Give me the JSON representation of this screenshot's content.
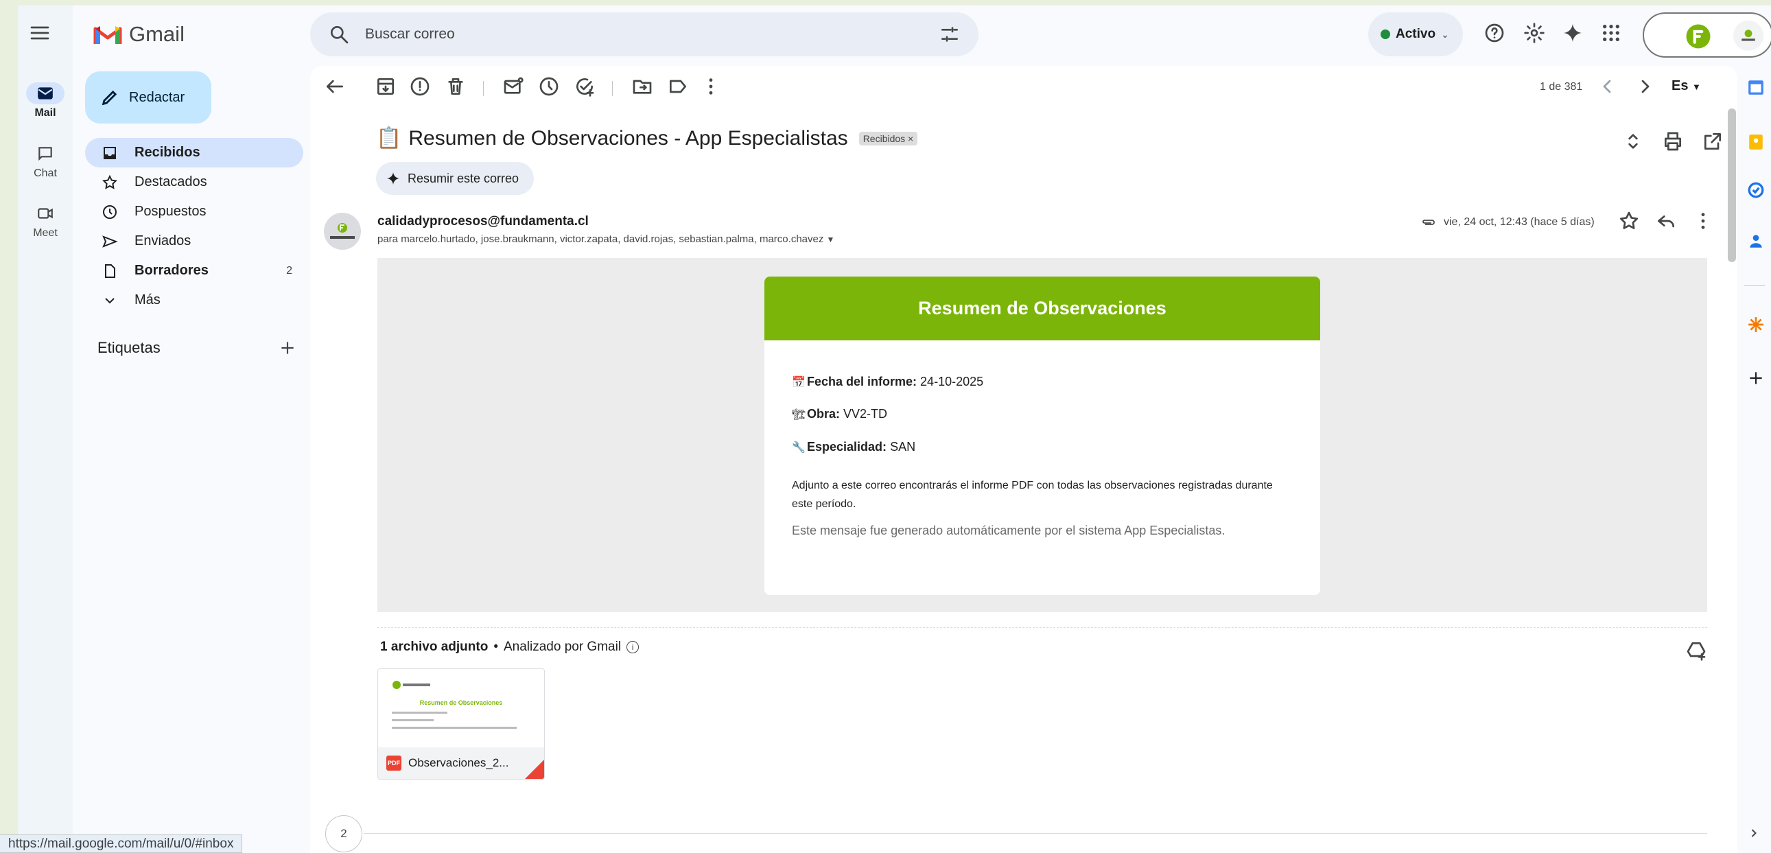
{
  "app": {
    "name": "Gmail"
  },
  "rail": {
    "items": [
      {
        "label": "Mail"
      },
      {
        "label": "Chat"
      },
      {
        "label": "Meet"
      }
    ]
  },
  "nav": {
    "compose": "Redactar",
    "items": [
      {
        "label": "Recibidos",
        "count": ""
      },
      {
        "label": "Destacados",
        "count": ""
      },
      {
        "label": "Pospuestos",
        "count": ""
      },
      {
        "label": "Enviados",
        "count": ""
      },
      {
        "label": "Borradores",
        "count": "2"
      },
      {
        "label": "Más",
        "count": ""
      }
    ],
    "labels_title": "Etiquetas"
  },
  "search": {
    "placeholder": "Buscar correo"
  },
  "status": {
    "label": "Activo"
  },
  "toolbar": {
    "pager": "1 de 381",
    "lang": "Es"
  },
  "message": {
    "subject_emoji": "📋",
    "subject": "Resumen de Observaciones - App Especialistas",
    "tag": "Recibidos ×",
    "summarize": "Resumir este correo",
    "sender": "calidadyprocesos@fundamenta.cl",
    "recipients": "para marcelo.hurtado, jose.braukmann, victor.zapata, david.rojas, sebastian.palma, marco.chavez",
    "date": "vie, 24 oct, 12:43 (hace 5 días)"
  },
  "email_card": {
    "header": "Resumen de Observaciones",
    "fecha_label": "Fecha del informe:",
    "fecha_value": "24-10-2025",
    "obra_label": "Obra:",
    "obra_value": "VV2-TD",
    "esp_label": "Especialidad:",
    "esp_value": "SAN",
    "paragraph": "Adjunto a este correo encontrarás el informe PDF con todas las observaciones registradas durante este período.",
    "footer": "Este mensaje fue generado automáticamente por el sistema App Especialistas."
  },
  "attachments": {
    "count_label": "1 archivo adjunto",
    "scanned": "Analizado por Gmail",
    "file_name": "Observaciones_2...",
    "preview_title": "Resumen de Observaciones"
  },
  "thread": {
    "count": "2"
  },
  "status_bar": {
    "url": "https://mail.google.com/mail/u/0/#inbox"
  },
  "colors": {
    "accent_green": "#7cb509",
    "compose_bg": "#c2e7ff",
    "active_nav": "#d3e3fd"
  }
}
